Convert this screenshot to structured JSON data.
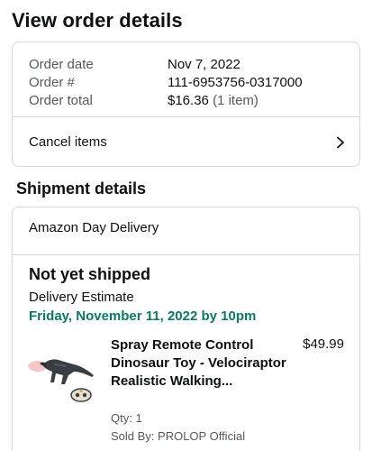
{
  "page": {
    "title": "View order details"
  },
  "summary": {
    "rows": [
      {
        "label": "Order date",
        "value": "Nov 7, 2022"
      },
      {
        "label": "Order #",
        "value": "111-6953756-0317000"
      },
      {
        "label": "Order total",
        "value": "$16.36",
        "extra": "(1 item)"
      }
    ],
    "cancel_label": "Cancel items"
  },
  "shipment": {
    "section_title": "Shipment details",
    "delivery_type": "Amazon Day Delivery",
    "status": "Not yet shipped",
    "estimate_label": "Delivery Estimate",
    "estimate_date": "Friday, November 11, 2022 by 10pm",
    "item": {
      "title": "Spray Remote Control Dinosaur Toy - Velociraptor Realistic Walking...",
      "price": "$49.99",
      "qty": "Qty: 1",
      "sold_by": "Sold By: PROLOP Official"
    }
  },
  "colors": {
    "text": "#0f1111",
    "muted": "#565959",
    "border": "#d5d9d9",
    "delivery_green": "#067d62"
  }
}
